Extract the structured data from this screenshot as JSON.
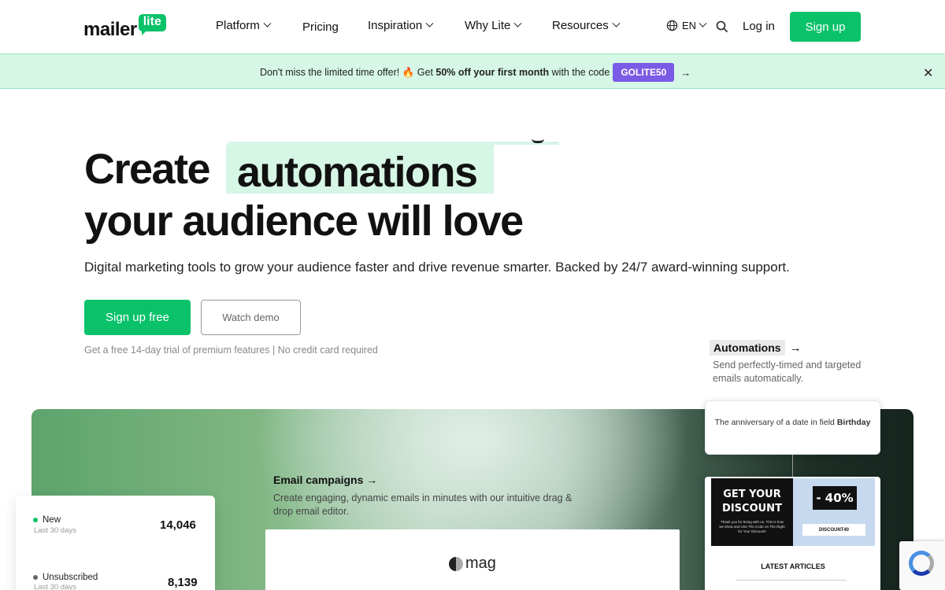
{
  "nav": {
    "logo_word": "mailer",
    "logo_badge": "lite",
    "items": [
      {
        "label": "Platform",
        "dropdown": true
      },
      {
        "label": "Pricing",
        "dropdown": false
      },
      {
        "label": "Inspiration",
        "dropdown": true
      },
      {
        "label": "Why Lite",
        "dropdown": true
      },
      {
        "label": "Resources",
        "dropdown": true
      }
    ],
    "lang": "EN",
    "login": "Log in",
    "signup": "Sign up"
  },
  "promo": {
    "text_start": "Don't miss the limited time offer!",
    "fire": "🔥",
    "text_get": "Get",
    "bold": "50% off your first month",
    "text_code": "with the code",
    "code": "GOLITE50",
    "arrow": "→",
    "close": "✕"
  },
  "hero": {
    "line1_start": "Create",
    "highlight": "automations",
    "line2": "your audience will love",
    "subtitle": "Digital marketing tools to grow your audience faster and drive revenue smarter. Backed by 24/7 award-winning support.",
    "cta_primary": "Sign up free",
    "cta_secondary": "Watch demo",
    "note": "Get a free 14-day trial of premium features | No credit card required"
  },
  "campaigns": {
    "title": "Email campaigns →",
    "desc": "Create engaging, dynamic emails in minutes with our intuitive drag & drop email editor.",
    "mag_word": "mag"
  },
  "stats": [
    {
      "label": "New",
      "sub": "Last 30 days",
      "value": "14,046",
      "color": "#09c269"
    },
    {
      "label": "Unsubscribed",
      "sub": "Last 30 days",
      "value": "8,139",
      "color": "#666666"
    }
  ],
  "automations": {
    "label": "Automations",
    "arrow": "→",
    "desc": "Send perfectly-timed and targeted emails automatically.",
    "trigger_text": "The anniversary of a date in field",
    "trigger_field": "Birthday"
  },
  "email_preview": {
    "headline": "GET YOUR DISCOUNT",
    "small": "Thank you for being with us. This is how we show and Use The Code on The Right for Your Discount!",
    "percent": "- 40%",
    "code": "DISCOUNT40",
    "latest": "LATEST ARTICLES"
  },
  "colors": {
    "brand_green": "#09c269",
    "promo_bg": "#d6f6e6",
    "code_purple": "#7a5be6"
  }
}
